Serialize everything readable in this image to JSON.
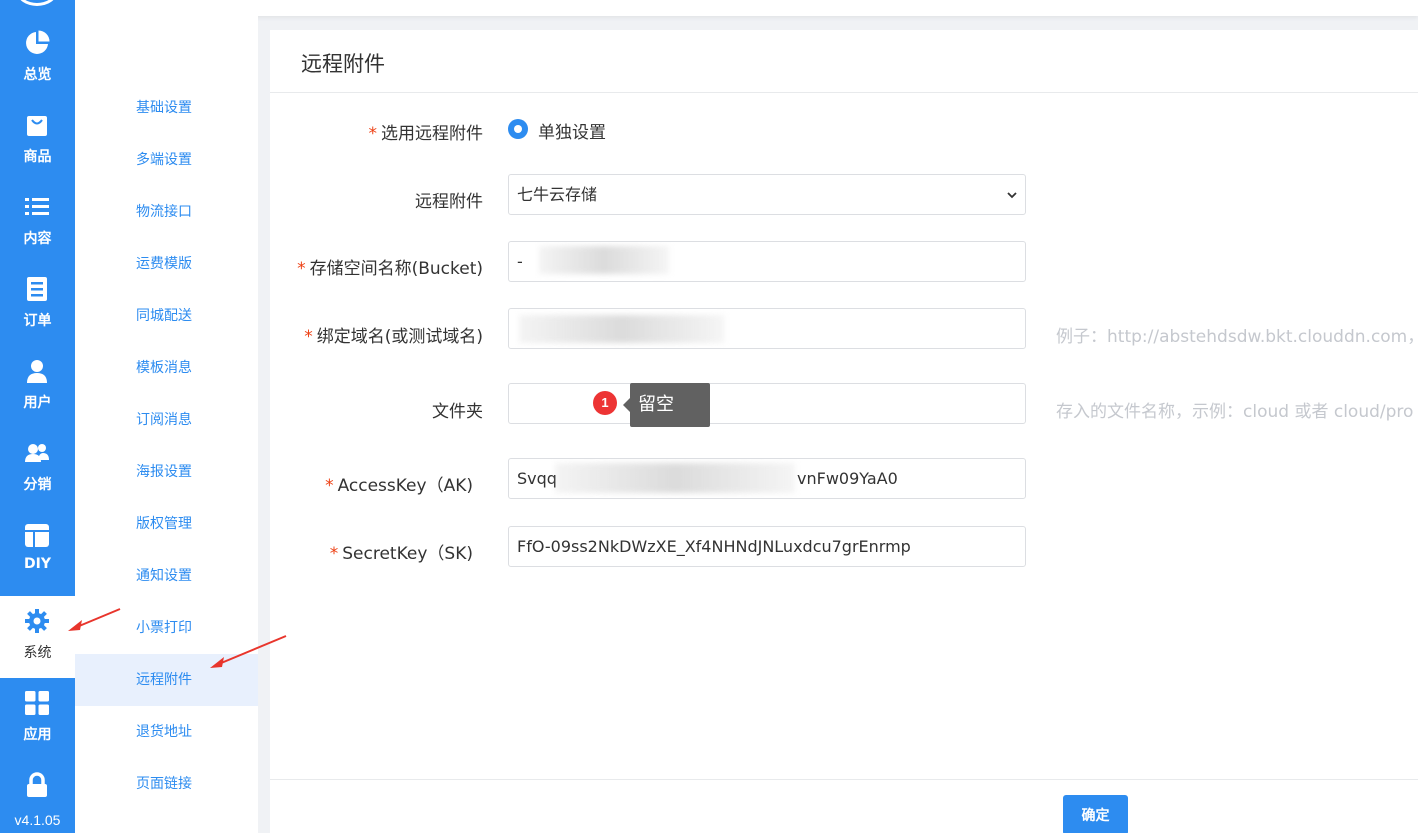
{
  "rail": {
    "items": [
      {
        "label": "总览",
        "icon": "pie-chart-icon"
      },
      {
        "label": "商品",
        "icon": "shopping-bag-icon"
      },
      {
        "label": "内容",
        "icon": "list-icon"
      },
      {
        "label": "订单",
        "icon": "document-icon"
      },
      {
        "label": "用户",
        "icon": "user-icon"
      },
      {
        "label": "分销",
        "icon": "users-icon"
      },
      {
        "label": "DIY",
        "icon": "layout-icon"
      },
      {
        "label": "系统",
        "icon": "gear-icon"
      },
      {
        "label": "应用",
        "icon": "apps-grid-icon"
      }
    ],
    "version": "v4.1.05",
    "accent": "#2d8cf0"
  },
  "submenu": {
    "items": [
      "基础设置",
      "多端设置",
      "物流接口",
      "运费模版",
      "同城配送",
      "模板消息",
      "订阅消息",
      "海报设置",
      "版权管理",
      "通知设置",
      "小票打印",
      "远程附件",
      "退货地址",
      "页面链接"
    ],
    "active": "远程附件"
  },
  "card": {
    "title": "远程附件",
    "form": {
      "select_remote": {
        "label": "选用远程附件",
        "option": "单独设置"
      },
      "remote_type": {
        "label": "远程附件",
        "value": "七牛云存储"
      },
      "bucket": {
        "label": "存储空间名称(Bucket)",
        "value": "-"
      },
      "domain": {
        "label": "绑定域名(或测试域名)",
        "value": "",
        "hint": "例子：http://abstehdsdw.bkt.clouddn.com，"
      },
      "folder": {
        "label": "文件夹",
        "value": "",
        "hint": "存入的文件名称，示例：cloud 或者 cloud/pro"
      },
      "access_key": {
        "label": "AccessKey（AK)",
        "value_start": "Svqq",
        "value_end": "vnFw09YaA0"
      },
      "secret_key": {
        "label": "SecretKey（SK)",
        "value": "FfO-09ss2NkDWzXE_Xf4NHNdJNLuxdcu7grEnrmp"
      }
    },
    "tooltip": {
      "badge": "1",
      "text": "留空"
    },
    "submit_label": "确定"
  }
}
